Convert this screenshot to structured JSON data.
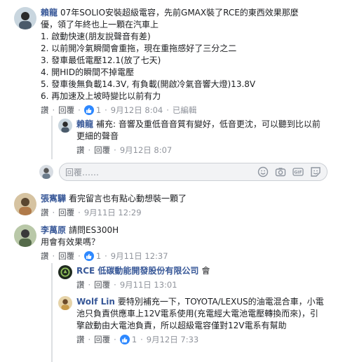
{
  "reply_placeholder": "回覆……",
  "actions": {
    "like": "讚",
    "reply": "回覆",
    "sep": "·"
  },
  "comments": [
    {
      "author": "賴龍",
      "lines": [
        "07年SOLIO安裝超級電容，先前GMAX裝了RCE的東西效果那麼",
        "優，領了年終也上一顆在汽車上",
        "1. 啟動快速(朋友說聲音有差)",
        "2. 以前開冷氣瞬間會重拖，現在重拖感好了三分之二",
        "3. 發車最低電壓12.1(放了七天)",
        "4. 開HID的瞬間不掉電壓",
        "5. 發車後無負載14.3V, 有負載(開啟冷氣音響大燈)13.8V",
        "6. 再加速及上坡時變比以前有力"
      ],
      "likes": "1",
      "time": "9月12日 8:04",
      "edited": "已編輯"
    },
    {
      "author": "賴龍",
      "lines": [
        "補充: 音響及重低音音質有變好，低音更沈，可以聽到比以前",
        "更細的聲音"
      ],
      "time": "9月12日 8:07"
    },
    {
      "author": "張寯驊",
      "lines": [
        "看完留言也有點心動想裝一顆了"
      ],
      "time": "9月11日 12:29"
    },
    {
      "author": "李萬原",
      "lines": [
        "請問ES300H",
        "用會有效果嗎？"
      ],
      "likes": "1",
      "time": "9月11日 12:37"
    },
    {
      "author": "RCE 低碳動能開發股份有限公司",
      "suffix": "會",
      "time": "9月11日 13:01"
    },
    {
      "author": "Wolf Lin",
      "lines": [
        "要特別補充一下，TOYOTA/LEXUS的油電混合車，小電",
        "池只負責供應車上12V電系使用(充電經大電池電壓轉換而來)，引",
        "擎啟動由大電池負責，所以超級電容僅對12V電系有幫助"
      ],
      "likes": "1",
      "time": "9月12日 7:33"
    }
  ],
  "icons": [
    "like-icon",
    "emoji-icon",
    "camera-icon",
    "gif-icon",
    "sticker-icon"
  ],
  "colors": {
    "link": "#385898",
    "meta": "#90949c",
    "like": "#2d88ff",
    "border": "#dddfe2"
  }
}
